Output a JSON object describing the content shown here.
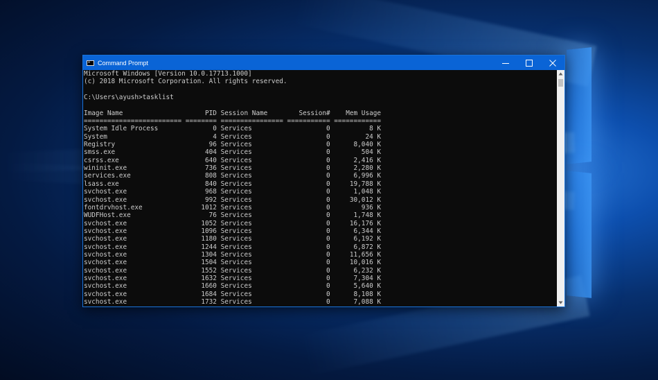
{
  "window": {
    "title": "Command Prompt",
    "minimize_glyph": "—",
    "maximize_glyph": "□",
    "close_glyph": "✕",
    "icon": "cmd-icon"
  },
  "console": {
    "header_lines": [
      "Microsoft Windows [Version 10.0.17713.1000]",
      "(c) 2018 Microsoft Corporation. All rights reserved.",
      "",
      "C:\\Users\\ayush>tasklist",
      ""
    ],
    "table_header": {
      "image_name": "Image Name",
      "pid": "PID",
      "session_name": "Session Name",
      "session_num": "Session#",
      "mem_usage": "Mem Usage"
    },
    "separator": "========================= ======== ================ =========== ============",
    "rows": [
      {
        "image": "System Idle Process",
        "pid": "0",
        "session": "Services",
        "num": "0",
        "mem": "8 K"
      },
      {
        "image": "System",
        "pid": "4",
        "session": "Services",
        "num": "0",
        "mem": "24 K"
      },
      {
        "image": "Registry",
        "pid": "96",
        "session": "Services",
        "num": "0",
        "mem": "8,040 K"
      },
      {
        "image": "smss.exe",
        "pid": "404",
        "session": "Services",
        "num": "0",
        "mem": "504 K"
      },
      {
        "image": "csrss.exe",
        "pid": "640",
        "session": "Services",
        "num": "0",
        "mem": "2,416 K"
      },
      {
        "image": "wininit.exe",
        "pid": "736",
        "session": "Services",
        "num": "0",
        "mem": "2,280 K"
      },
      {
        "image": "services.exe",
        "pid": "808",
        "session": "Services",
        "num": "0",
        "mem": "6,996 K"
      },
      {
        "image": "lsass.exe",
        "pid": "840",
        "session": "Services",
        "num": "0",
        "mem": "19,788 K"
      },
      {
        "image": "svchost.exe",
        "pid": "968",
        "session": "Services",
        "num": "0",
        "mem": "1,048 K"
      },
      {
        "image": "svchost.exe",
        "pid": "992",
        "session": "Services",
        "num": "0",
        "mem": "30,012 K"
      },
      {
        "image": "fontdrvhost.exe",
        "pid": "1012",
        "session": "Services",
        "num": "0",
        "mem": "936 K"
      },
      {
        "image": "WUDFHost.exe",
        "pid": "76",
        "session": "Services",
        "num": "0",
        "mem": "1,748 K"
      },
      {
        "image": "svchost.exe",
        "pid": "1052",
        "session": "Services",
        "num": "0",
        "mem": "16,176 K"
      },
      {
        "image": "svchost.exe",
        "pid": "1096",
        "session": "Services",
        "num": "0",
        "mem": "6,344 K"
      },
      {
        "image": "svchost.exe",
        "pid": "1180",
        "session": "Services",
        "num": "0",
        "mem": "6,192 K"
      },
      {
        "image": "svchost.exe",
        "pid": "1244",
        "session": "Services",
        "num": "0",
        "mem": "6,872 K"
      },
      {
        "image": "svchost.exe",
        "pid": "1304",
        "session": "Services",
        "num": "0",
        "mem": "11,656 K"
      },
      {
        "image": "svchost.exe",
        "pid": "1504",
        "session": "Services",
        "num": "0",
        "mem": "10,016 K"
      },
      {
        "image": "svchost.exe",
        "pid": "1552",
        "session": "Services",
        "num": "0",
        "mem": "6,232 K"
      },
      {
        "image": "svchost.exe",
        "pid": "1632",
        "session": "Services",
        "num": "0",
        "mem": "7,304 K"
      },
      {
        "image": "svchost.exe",
        "pid": "1660",
        "session": "Services",
        "num": "0",
        "mem": "5,640 K"
      },
      {
        "image": "svchost.exe",
        "pid": "1684",
        "session": "Services",
        "num": "0",
        "mem": "8,108 K"
      },
      {
        "image": "svchost.exe",
        "pid": "1732",
        "session": "Services",
        "num": "0",
        "mem": "7,088 K"
      }
    ]
  },
  "colors": {
    "titlebar": "#0a64d6",
    "console_bg": "#0c0c0c",
    "console_text": "#cccccc"
  }
}
